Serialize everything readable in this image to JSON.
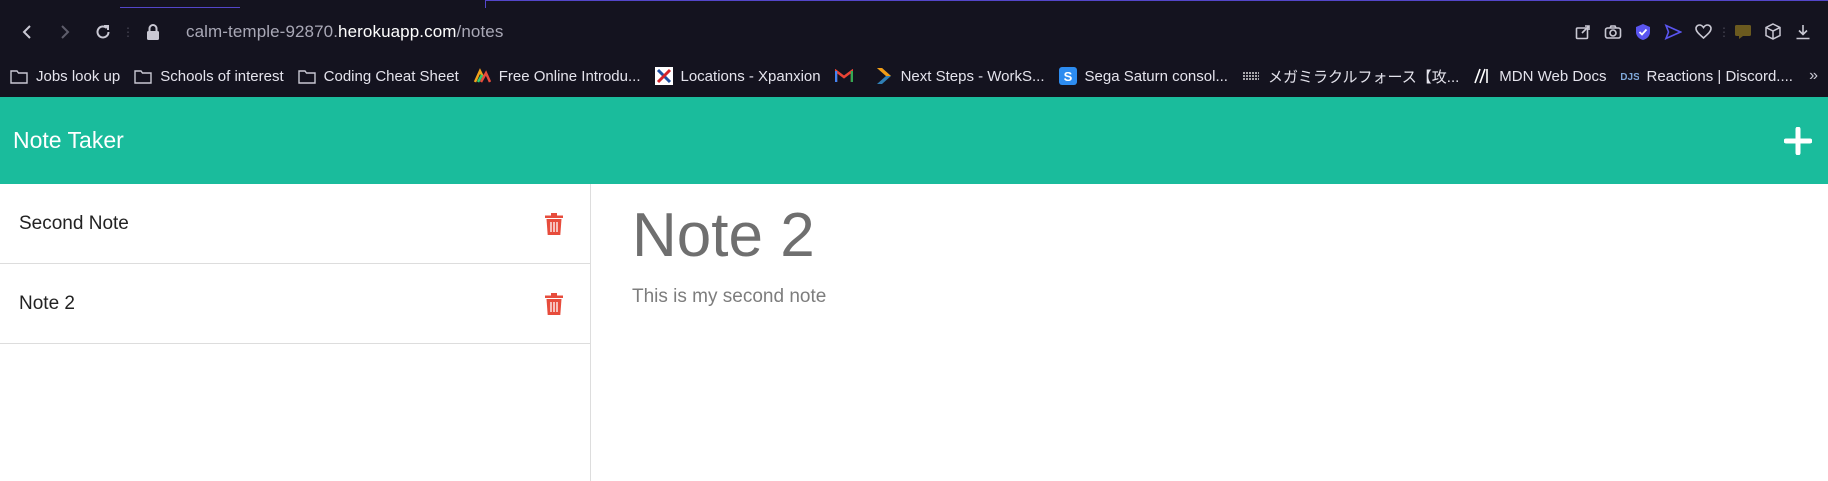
{
  "browser": {
    "url_prefix": "calm-temple-92870.",
    "url_host": "herokuapp.com",
    "url_path": "/notes",
    "bookmarks": [
      {
        "label": "Jobs look up",
        "icon": "folder-icon"
      },
      {
        "label": "Schools of interest",
        "icon": "folder-icon"
      },
      {
        "label": "Coding Cheat Sheet",
        "icon": "folder-icon"
      },
      {
        "label": "Free Online Introdu...",
        "icon": "triangle-logo-icon"
      },
      {
        "label": "Locations - Xpanxion",
        "icon": "x-logo-icon"
      },
      {
        "label": "",
        "icon": "gmail-icon"
      },
      {
        "label": "Next Steps - WorkS...",
        "icon": "chevron-logo-icon"
      },
      {
        "label": "Sega Saturn consol...",
        "icon": "s-logo-icon"
      },
      {
        "label": "メガミラクルフォース【攻...",
        "icon": "game-logo-icon"
      },
      {
        "label": "MDN Web Docs",
        "icon": "mdn-icon"
      },
      {
        "label": "Reactions | Discord....",
        "icon": "djs-icon"
      }
    ],
    "overflow_label": "»"
  },
  "app": {
    "title": "Note Taker",
    "accent": "#1abc9c",
    "delete_color": "#e74c3c"
  },
  "notes": [
    {
      "title": "Second Note"
    },
    {
      "title": "Note 2"
    }
  ],
  "active_note": {
    "title": "Note 2",
    "text": "This is my second note"
  }
}
